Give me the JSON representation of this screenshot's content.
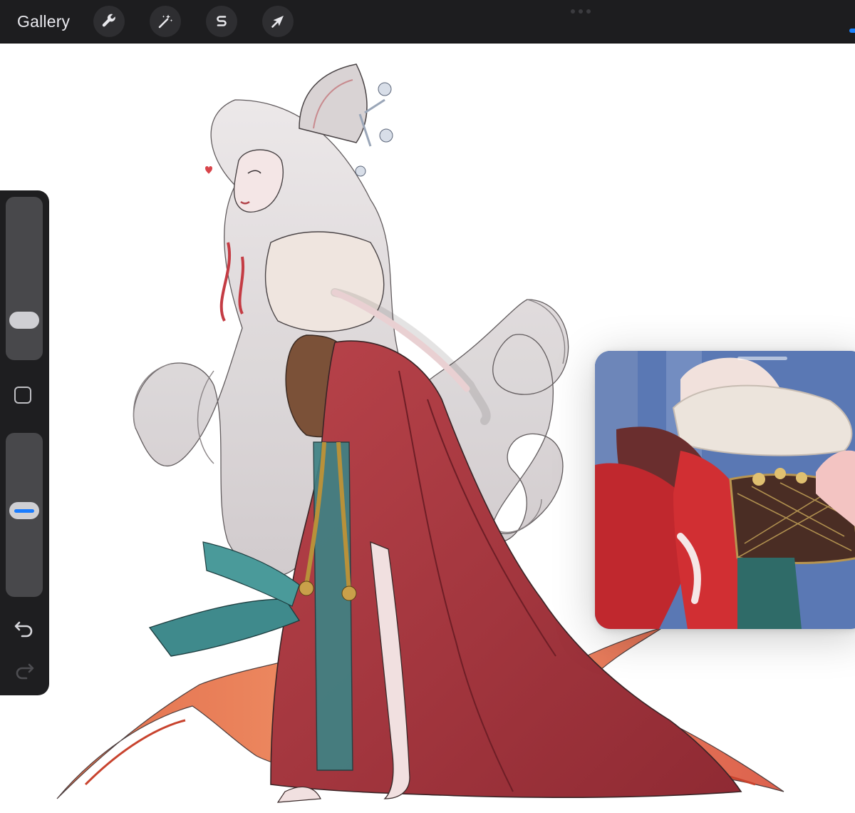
{
  "toolbar": {
    "gallery_label": "Gallery",
    "tools": [
      {
        "name": "actions",
        "icon": "wrench-icon"
      },
      {
        "name": "adjustments",
        "icon": "magic-wand-icon"
      },
      {
        "name": "selection",
        "icon": "selection-s-icon"
      },
      {
        "name": "transform",
        "icon": "arrow-cursor-icon"
      }
    ]
  },
  "sidebar": {
    "brush_size_level": 0.2,
    "brush_opacity_level": 0.53,
    "modify_icon": "square-icon",
    "undo_icon": "undo-arrow-icon",
    "redo_icon": "redo-arrow-icon",
    "redo_enabled": false
  },
  "canvas": {
    "artwork": "fox-spirit-character-sketch",
    "reference_window": true
  },
  "colors": {
    "toolbar_bg": "#1d1d1f",
    "sidebar_bg": "#1e1e20",
    "accent": "#1a7cff",
    "robe_red": "#a8343c",
    "sash_teal": "#3f8a8c",
    "hair_gray": "#d8d3d4"
  }
}
